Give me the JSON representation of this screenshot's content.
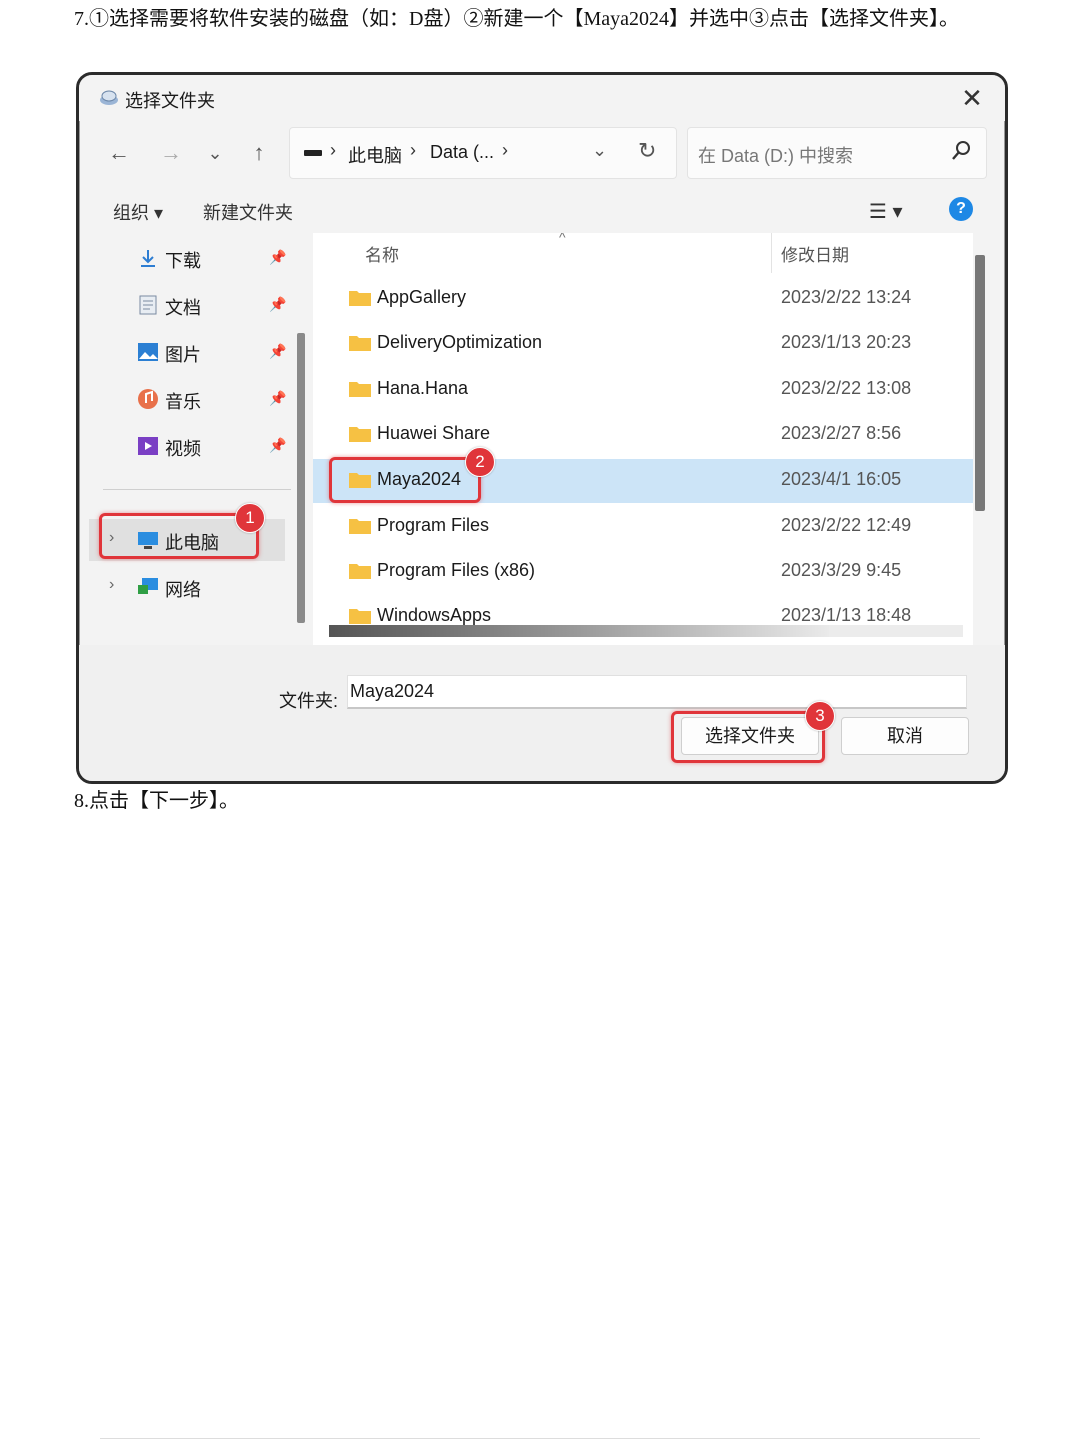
{
  "doc": {
    "step7": "7.①选择需要将软件安装的磁盘（如：D盘）②新建一个【Maya2024】并选中③点击【选择文件夹】。",
    "step8": "8.点击【下一步】。"
  },
  "dialog": {
    "title": "选择文件夹",
    "close_icon": "close-icon",
    "nav": {
      "back": "←",
      "forward": "→",
      "recent": "⌄",
      "up": "↑"
    },
    "address": {
      "crumbs": [
        "此电脑",
        "Data (..."
      ],
      "sep": "›"
    },
    "search_placeholder": "在 Data (D:) 中搜索",
    "commands": {
      "organize": "组织 ▾",
      "new_folder": "新建文件夹"
    },
    "sidebar": {
      "quick": [
        {
          "label": "下载",
          "icon": "download-icon"
        },
        {
          "label": "文档",
          "icon": "document-icon"
        },
        {
          "label": "图片",
          "icon": "picture-icon"
        },
        {
          "label": "音乐",
          "icon": "music-icon"
        },
        {
          "label": "视频",
          "icon": "video-icon"
        }
      ],
      "this_pc": "此电脑",
      "network": "网络"
    },
    "columns": {
      "name": "名称",
      "date": "修改日期"
    },
    "files": [
      {
        "name": "AppGallery",
        "date": "2023/2/22 13:24"
      },
      {
        "name": "DeliveryOptimization",
        "date": "2023/1/13 20:23"
      },
      {
        "name": "Hana.Hana",
        "date": "2023/2/22 13:08"
      },
      {
        "name": "Huawei Share",
        "date": "2023/2/27 8:56"
      },
      {
        "name": "Maya2024",
        "date": "2023/4/1 16:05"
      },
      {
        "name": "Program Files",
        "date": "2023/2/22 12:49"
      },
      {
        "name": "Program Files (x86)",
        "date": "2023/3/29 9:45"
      },
      {
        "name": "WindowsApps",
        "date": "2023/1/13 18:48"
      }
    ],
    "selected_file": "Maya2024",
    "folder_label": "文件夹:",
    "folder_value": "Maya2024",
    "select_button": "选择文件夹",
    "cancel_button": "取消"
  },
  "annotations": {
    "badge1": "1",
    "badge2": "2",
    "badge3": "3",
    "color": "#e0353a"
  },
  "colors": {
    "selected_row": "#cce4f7",
    "folder": "#f6c143",
    "help": "#1e88e5"
  }
}
